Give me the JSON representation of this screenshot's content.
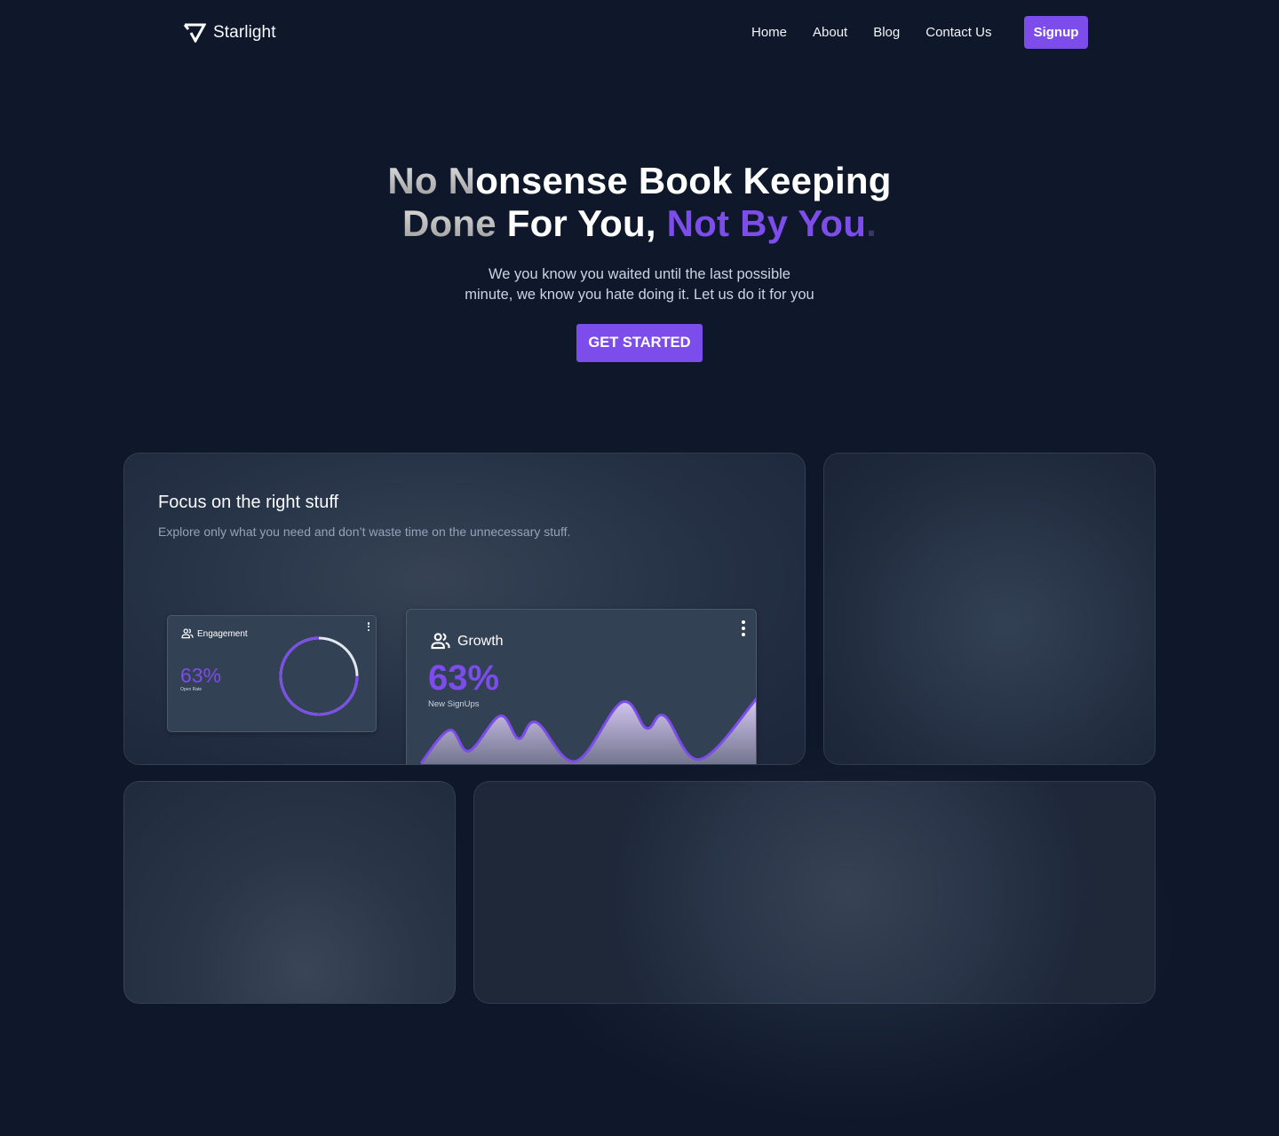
{
  "brand": {
    "name": "Starlight",
    "logo_icon": "check-triangle-icon"
  },
  "nav": {
    "links": [
      {
        "label": "Home"
      },
      {
        "label": "About"
      },
      {
        "label": "Blog"
      },
      {
        "label": "Contact Us"
      }
    ],
    "signup_label": "Signup"
  },
  "hero": {
    "title_line1_dim": "No N",
    "title_line1_white": "onsense Book Keeping",
    "title_line2_dim": "Done",
    "title_line2_white": " For You, ",
    "title_line2_accent": "Not By You",
    "title_line2_dot": ".",
    "subtitle_line1": "We you know you waited until the last possible",
    "subtitle_line2": "minute, we know you hate doing it. Let us do it for you",
    "cta_label": "GET STARTED"
  },
  "feature_card": {
    "title": "Focus on the right stuff",
    "subtitle": "Explore only what you need and don’t waste time on the unnecessary stuff."
  },
  "engagement_widget": {
    "title": "Engagement",
    "icon": "users-icon",
    "value": "63%",
    "label": "Open Rate",
    "ring_progress": 0.75
  },
  "growth_widget": {
    "title": "Growth",
    "icon": "users-icon",
    "value": "63%",
    "label": "New SignUps",
    "wave_values": [
      0,
      0.51,
      0.19,
      0.73,
      0.38,
      0.63,
      0.03,
      0.94,
      0.54,
      0.73,
      0.06,
      1.0
    ]
  },
  "colors": {
    "background": "#0f172a",
    "accent": "#7c4dea",
    "card": "#1e293b",
    "widget": "#334155",
    "ring_track": "#e2e8f0"
  }
}
